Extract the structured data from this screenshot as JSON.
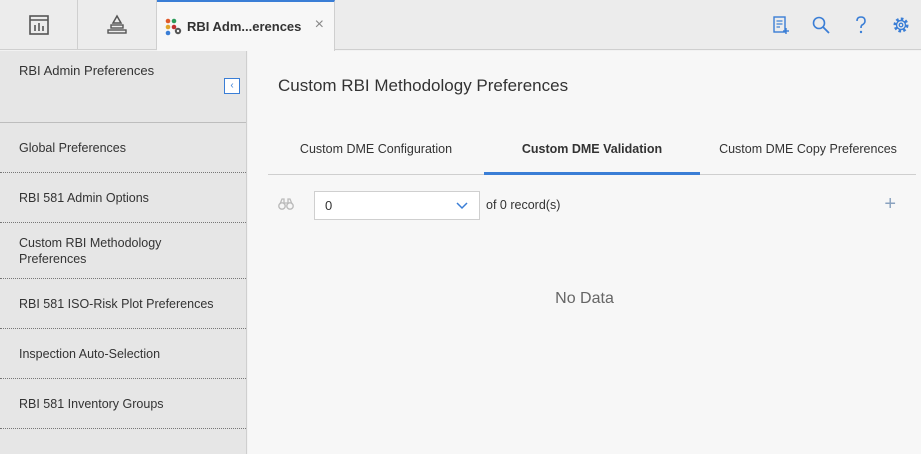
{
  "topbar": {
    "left_buttons": [
      {
        "icon": "dashboard-icon"
      },
      {
        "icon": "asset-hierarchy-icon"
      }
    ],
    "active_tab": {
      "icon": "rbi-app-icon",
      "title": "RBI Adm...erences",
      "close": "×"
    },
    "right_icons": [
      "new-record-icon",
      "search-icon",
      "help-icon",
      "settings-icon"
    ]
  },
  "sidebar": {
    "title": "RBI Admin Preferences",
    "collapse": "‹",
    "items": [
      {
        "label": "Global Preferences"
      },
      {
        "label": "RBI 581 Admin Options"
      },
      {
        "label": "Custom RBI Methodology Preferences"
      },
      {
        "label": "RBI 581 ISO-Risk Plot Preferences"
      },
      {
        "label": "Inspection Auto-Selection"
      },
      {
        "label": "RBI 581 Inventory Groups"
      }
    ]
  },
  "main": {
    "title": "Custom RBI Methodology Preferences",
    "tabs": [
      {
        "label": "Custom DME Configuration"
      },
      {
        "label": "Custom DME Validation"
      },
      {
        "label": "Custom DME Copy Preferences"
      }
    ],
    "toolbar": {
      "select_value": "0",
      "of_label": "of",
      "record_count": "0",
      "records_label": "record(s)",
      "add": "+"
    },
    "no_data": "No Data"
  },
  "colors": {
    "accent": "#3a7ed6",
    "sidebar_bg": "#e6e6e6",
    "content_bg": "#f7f7f7"
  }
}
